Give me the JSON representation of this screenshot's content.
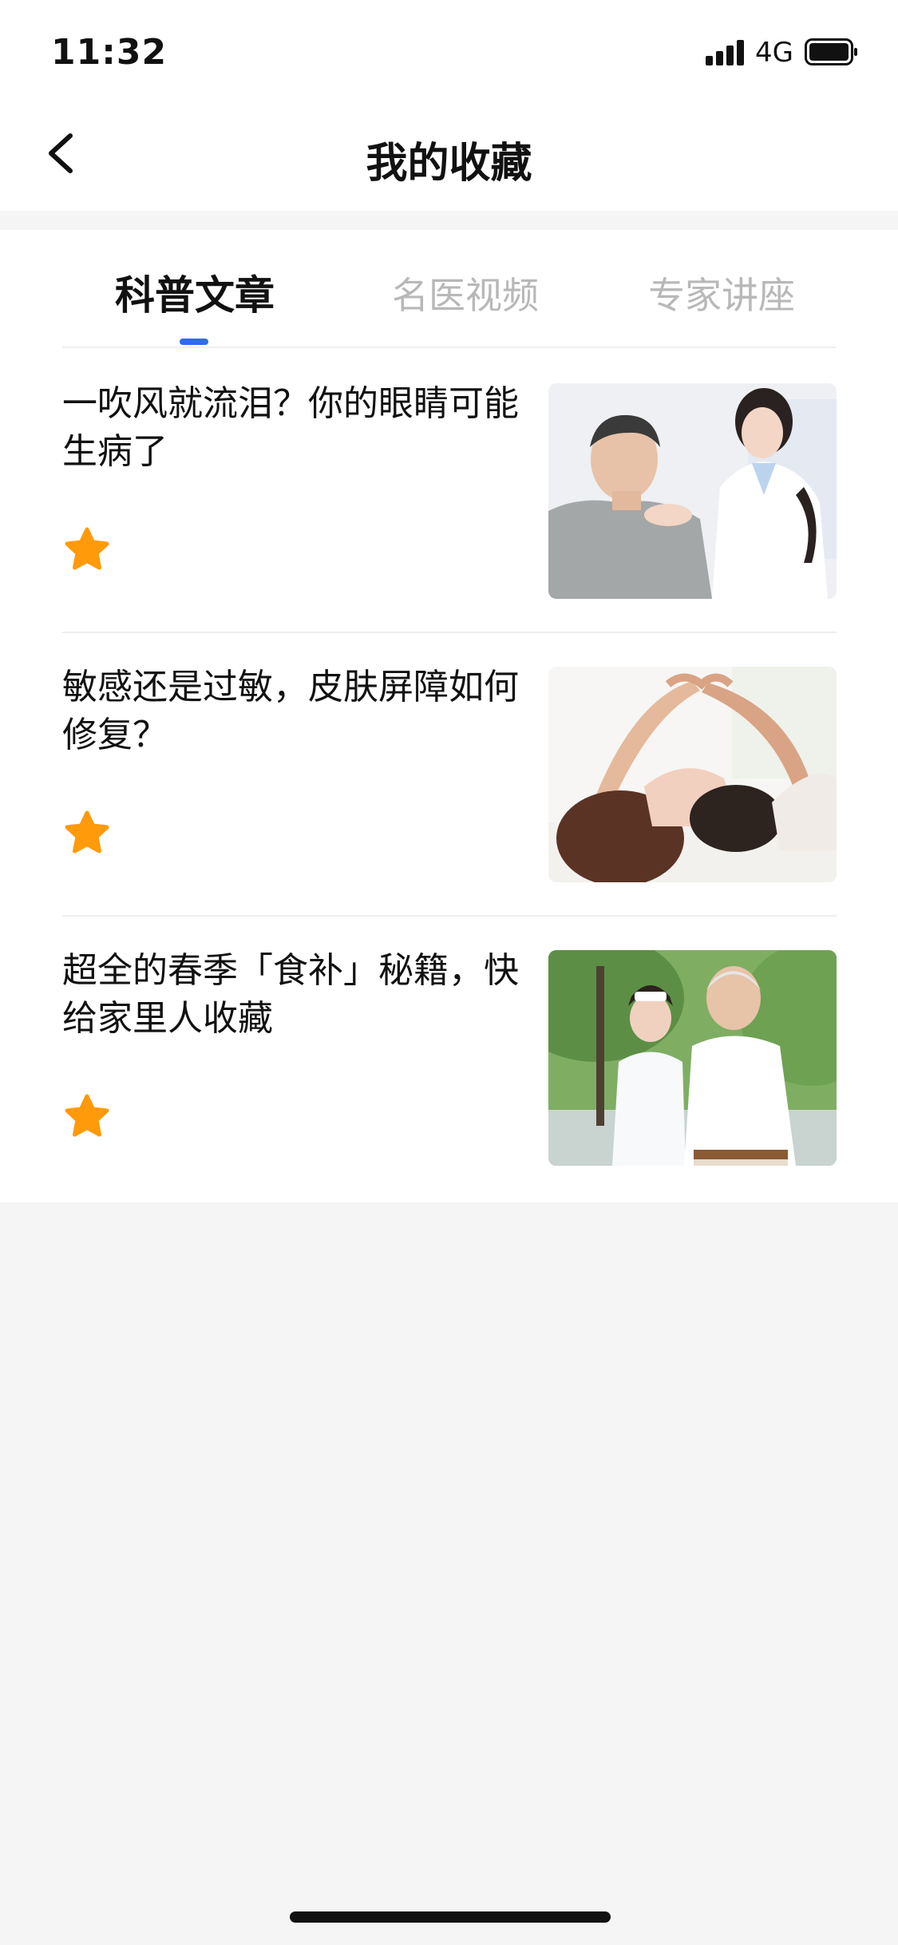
{
  "status_bar": {
    "time": "11:32",
    "network": "4G",
    "signal_icon": "signal-bars-icon",
    "battery_icon": "battery-icon"
  },
  "header": {
    "title": "我的收藏",
    "back_icon": "chevron-left-icon"
  },
  "tabs": [
    {
      "label": "科普文章",
      "active": true
    },
    {
      "label": "名医视频",
      "active": false
    },
    {
      "label": "专家讲座",
      "active": false
    }
  ],
  "articles": [
    {
      "title": "一吹风就流泪？你的眼睛可能生病了",
      "favorite_icon": "star-icon",
      "image": "doctor-examining-patient-photo"
    },
    {
      "title": "敏感还是过敏，皮肤屏障如何修复？",
      "favorite_icon": "star-icon",
      "image": "couple-making-heart-photo"
    },
    {
      "title": "超全的春季「食补」秘籍，快给家里人收藏",
      "favorite_icon": "star-icon",
      "image": "nurse-with-elderly-man-photo"
    }
  ],
  "colors": {
    "accent": "#2f6bf0",
    "star": "#ff9a0a",
    "inactive_tab": "#b8b8b8",
    "background": "#f5f5f5"
  }
}
